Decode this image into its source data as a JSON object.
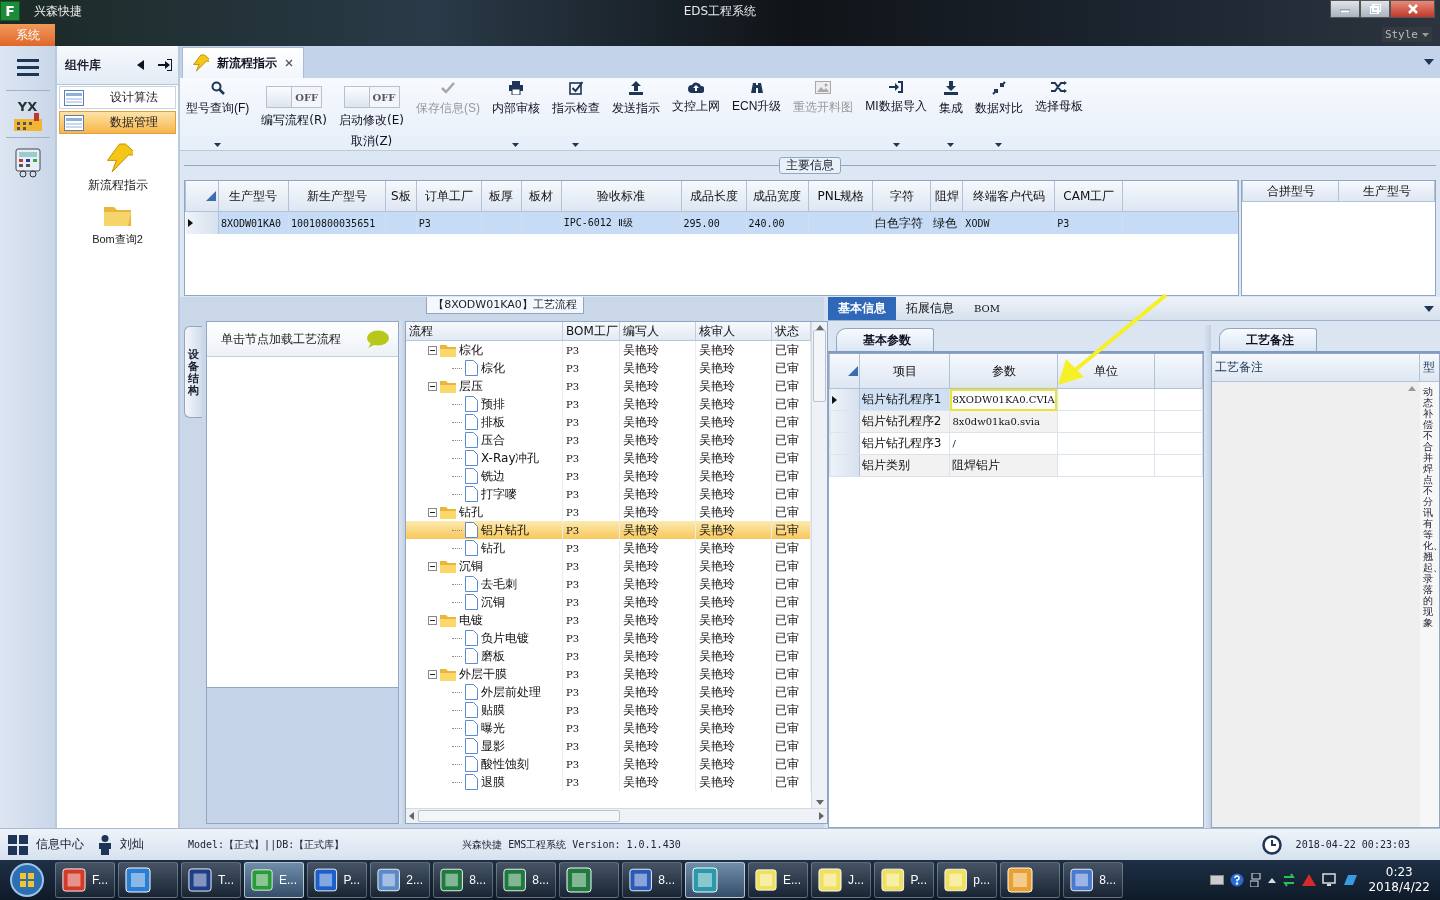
{
  "window": {
    "logo": "F",
    "app_name": "兴森快捷",
    "title": "EDS工程系统",
    "menu_tab": "系统",
    "style_label": "Style"
  },
  "rail": {
    "logo_text": "YX"
  },
  "nav_panel": {
    "title": "组件库",
    "groups": [
      {
        "label": "设计算法",
        "selected": false
      },
      {
        "label": "数据管理",
        "selected": true
      }
    ],
    "items": [
      {
        "label": "新流程指示",
        "kind": "bolt"
      },
      {
        "label": "Bom查询2",
        "kind": "folder"
      }
    ]
  },
  "doc_tabs": [
    {
      "label": "新流程指示",
      "selected": true
    }
  ],
  "toolbar": [
    {
      "kind": "button",
      "label": "型号查询(F)",
      "dropdown": true,
      "disabled": false
    },
    {
      "kind": "toggle",
      "label": "编写流程(R)",
      "state_text": "OFF",
      "on": false
    },
    {
      "kind": "toggle",
      "label": "启动修改(E)",
      "sublabel": "取消(Z)",
      "state_text": "OFF",
      "on": false
    },
    {
      "kind": "button",
      "label": "保存信息(S)",
      "dropdown": false,
      "disabled": true
    },
    {
      "kind": "button",
      "label": "内部审核",
      "dropdown": true,
      "disabled": false
    },
    {
      "kind": "button",
      "label": "指示检查",
      "dropdown": true,
      "disabled": false
    },
    {
      "kind": "button",
      "label": "发送指示",
      "dropdown": false,
      "disabled": false
    },
    {
      "kind": "button",
      "label": "文控上网",
      "dropdown": false,
      "disabled": false
    },
    {
      "kind": "button",
      "label": "ECN升级",
      "dropdown": false,
      "disabled": false
    },
    {
      "kind": "button",
      "label": "重选开料图",
      "dropdown": false,
      "disabled": true
    },
    {
      "kind": "button",
      "label": "MI数据导入",
      "dropdown": true,
      "disabled": false
    },
    {
      "kind": "button",
      "label": "集成",
      "dropdown": true,
      "disabled": false
    },
    {
      "kind": "button",
      "label": "数据对比",
      "dropdown": true,
      "disabled": false
    },
    {
      "kind": "button",
      "label": "选择母板",
      "dropdown": false,
      "disabled": false
    }
  ],
  "main_info": {
    "title": "主要信息",
    "columns": [
      "生产型号",
      "新生产型号",
      "S板",
      "订单工厂",
      "板厚",
      "板材",
      "验收标准",
      "成品长度",
      "成品宽度",
      "PNL规格",
      "字符",
      "阻焊",
      "终端客户代码",
      "CAM工厂"
    ],
    "rows": [
      {
        "selected": true,
        "cells": [
          "8XODW01KA0",
          "10010800035651",
          null,
          "P3",
          null,
          null,
          "IPC-6012 Ⅱ级",
          "295.00",
          "240.00",
          null,
          "白色字符",
          "绿色",
          "XODW",
          "P3"
        ]
      }
    ],
    "side_columns": [
      "合拼型号",
      "生产型号"
    ]
  },
  "process": {
    "title": "【8XODW01KA0】工艺流程",
    "side_tab": "设备结构",
    "hint": "单击节点加载工艺流程",
    "columns": [
      "流程",
      "BOM工厂",
      "编写人",
      "核审人",
      "状态"
    ],
    "nodes": [
      {
        "name": "棕化",
        "factory": "P3",
        "author": "吴艳玲",
        "reviewer": "吴艳玲",
        "status": "已审",
        "expanded": true,
        "selected": false,
        "children": [
          {
            "name": "棕化",
            "factory": "P3",
            "author": "吴艳玲",
            "reviewer": "吴艳玲",
            "status": "已审",
            "selected": false
          }
        ]
      },
      {
        "name": "层压",
        "factory": "P3",
        "author": "吴艳玲",
        "reviewer": "吴艳玲",
        "status": "已审",
        "expanded": true,
        "selected": false,
        "children": [
          {
            "name": "预排",
            "factory": "P3",
            "author": "吴艳玲",
            "reviewer": "吴艳玲",
            "status": "已审",
            "selected": false
          },
          {
            "name": "排板",
            "factory": "P3",
            "author": "吴艳玲",
            "reviewer": "吴艳玲",
            "status": "已审",
            "selected": false
          },
          {
            "name": "压合",
            "factory": "P3",
            "author": "吴艳玲",
            "reviewer": "吴艳玲",
            "status": "已审",
            "selected": false
          },
          {
            "name": "X-Ray冲孔",
            "factory": "P3",
            "author": "吴艳玲",
            "reviewer": "吴艳玲",
            "status": "已审",
            "selected": false
          },
          {
            "name": "铣边",
            "factory": "P3",
            "author": "吴艳玲",
            "reviewer": "吴艳玲",
            "status": "已审",
            "selected": false
          },
          {
            "name": "打字嘜",
            "factory": "P3",
            "author": "吴艳玲",
            "reviewer": "吴艳玲",
            "status": "已审",
            "selected": false
          }
        ]
      },
      {
        "name": "钻孔",
        "factory": "P3",
        "author": "吴艳玲",
        "reviewer": "吴艳玲",
        "status": "已审",
        "expanded": true,
        "selected": false,
        "children": [
          {
            "name": "铝片钻孔",
            "factory": "P3",
            "author": "吴艳玲",
            "reviewer": "吴艳玲",
            "status": "已审",
            "selected": true
          },
          {
            "name": "钻孔",
            "factory": "P3",
            "author": "吴艳玲",
            "reviewer": "吴艳玲",
            "status": "已审",
            "selected": false
          }
        ]
      },
      {
        "name": "沉铜",
        "factory": "P3",
        "author": "吴艳玲",
        "reviewer": "吴艳玲",
        "status": "已审",
        "expanded": true,
        "selected": false,
        "children": [
          {
            "name": "去毛刺",
            "factory": "P3",
            "author": "吴艳玲",
            "reviewer": "吴艳玲",
            "status": "已审",
            "selected": false
          },
          {
            "name": "沉铜",
            "factory": "P3",
            "author": "吴艳玲",
            "reviewer": "吴艳玲",
            "status": "已审",
            "selected": false
          }
        ]
      },
      {
        "name": "电镀",
        "factory": "P3",
        "author": "吴艳玲",
        "reviewer": "吴艳玲",
        "status": "已审",
        "expanded": true,
        "selected": false,
        "children": [
          {
            "name": "负片电镀",
            "factory": "P3",
            "author": "吴艳玲",
            "reviewer": "吴艳玲",
            "status": "已审",
            "selected": false
          },
          {
            "name": "磨板",
            "factory": "P3",
            "author": "吴艳玲",
            "reviewer": "吴艳玲",
            "status": "已审",
            "selected": false
          }
        ]
      },
      {
        "name": "外层干膜",
        "factory": "P3",
        "author": "吴艳玲",
        "reviewer": "吴艳玲",
        "status": "已审",
        "expanded": true,
        "selected": false,
        "children": [
          {
            "name": "外层前处理",
            "factory": "P3",
            "author": "吴艳玲",
            "reviewer": "吴艳玲",
            "status": "已审",
            "selected": false
          },
          {
            "name": "贴膜",
            "factory": "P3",
            "author": "吴艳玲",
            "reviewer": "吴艳玲",
            "status": "已审",
            "selected": false
          },
          {
            "name": "曝光",
            "factory": "P3",
            "author": "吴艳玲",
            "reviewer": "吴艳玲",
            "status": "已审",
            "selected": false
          },
          {
            "name": "显影",
            "factory": "P3",
            "author": "吴艳玲",
            "reviewer": "吴艳玲",
            "status": "已审",
            "selected": false
          },
          {
            "name": "酸性蚀刻",
            "factory": "P3",
            "author": "吴艳玲",
            "reviewer": "吴艳玲",
            "status": "已审",
            "selected": false
          },
          {
            "name": "退膜",
            "factory": "P3",
            "author": "吴艳玲",
            "reviewer": "吴艳玲",
            "status": "已审",
            "selected": false
          }
        ]
      }
    ]
  },
  "detail": {
    "tabs": [
      {
        "label": "基本信息",
        "selected": true
      },
      {
        "label": "拓展信息",
        "selected": false
      },
      {
        "label": "BOM",
        "selected": false
      }
    ],
    "params": {
      "tab": "基本参数",
      "columns": [
        "项目",
        "参数",
        "单位"
      ],
      "rows": [
        {
          "item": "铝片钻孔程序1",
          "value": "8XODW01KA0.CVIA",
          "selected": true,
          "annotated": true
        },
        {
          "item": "铝片钻孔程序2",
          "value": "8x0dw01ka0.svia",
          "selected": false,
          "annotated": false
        },
        {
          "item": "铝片钻孔程序3",
          "value": "/",
          "selected": false,
          "annotated": false
        },
        {
          "item": "铝片类别",
          "value": "阻焊铝片",
          "selected": false,
          "annotated": false
        }
      ]
    },
    "notes": {
      "tab": "工艺备注",
      "columns": [
        "工艺备注",
        "型"
      ],
      "vertical_text": "动态补偿不合并焊点不分讯有等化、翘起、录落的现象"
    }
  },
  "status_bar": {
    "info_center": "信息中心",
    "user": "刘灿",
    "model": "Model:【正式】||DB:【正式库】",
    "version": "兴森快捷 EMS工程系统 Version: 1.0.1.430",
    "datetime": "2018-04-22 00:23:03"
  },
  "taskbar": {
    "items": [
      {
        "label": "F...",
        "selected": false
      },
      {
        "selected": false
      },
      {
        "label": "T...",
        "selected": false
      },
      {
        "label": "E...",
        "selected": true
      },
      {
        "label": "P...",
        "selected": false
      },
      {
        "label": "2...",
        "selected": false
      },
      {
        "label": "8...",
        "selected": false
      },
      {
        "label": "8...",
        "selected": false
      },
      {
        "selected": false
      },
      {
        "label": "8...",
        "selected": false
      },
      {
        "selected": true
      },
      {
        "label": "E...",
        "selected": false
      },
      {
        "label": "J...",
        "selected": false
      },
      {
        "label": "P...",
        "selected": false
      },
      {
        "label": "p...",
        "selected": false
      },
      {
        "selected": false
      },
      {
        "label": "8...",
        "selected": false
      }
    ],
    "time": "0:23",
    "date": "2018/4/22"
  }
}
